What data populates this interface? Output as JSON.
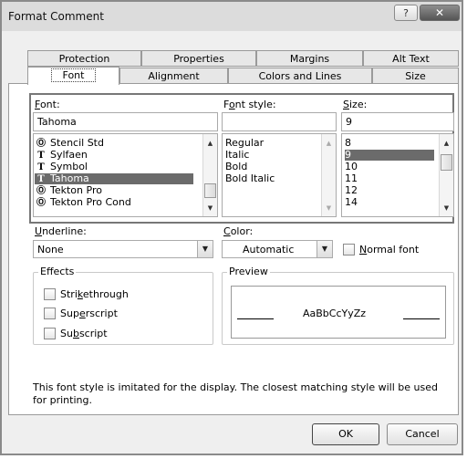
{
  "window": {
    "title": "Format Comment",
    "help_label": "?",
    "close_label": "✕"
  },
  "tabs_back": [
    "Protection",
    "Properties",
    "Margins",
    "Alt Text"
  ],
  "tabs_front": [
    "Font",
    "Alignment",
    "Colors and Lines",
    "Size"
  ],
  "active_tab": "Font",
  "font": {
    "label_prefix": "",
    "label_mnemonic": "F",
    "label_rest": "ont:",
    "value": "Tahoma",
    "items": [
      {
        "name": "Stencil Std",
        "icon": "printer-font-icon",
        "glyph": "Ⓞ"
      },
      {
        "name": "Sylfaen",
        "icon": "truetype-font-icon",
        "glyph": "T"
      },
      {
        "name": "Symbol",
        "icon": "truetype-font-icon",
        "glyph": "T"
      },
      {
        "name": "Tahoma",
        "icon": "truetype-font-icon",
        "glyph": "T",
        "selected": true
      },
      {
        "name": "Tekton Pro",
        "icon": "printer-font-icon",
        "glyph": "Ⓞ"
      },
      {
        "name": "Tekton Pro Cond",
        "icon": "printer-font-icon",
        "glyph": "Ⓞ"
      }
    ]
  },
  "font_style": {
    "label_prefix": "F",
    "label_mnemonic": "o",
    "label_rest": "nt style:",
    "value": "",
    "items": [
      "Regular",
      "Italic",
      "Bold",
      "Bold Italic"
    ]
  },
  "size": {
    "label_prefix": "",
    "label_mnemonic": "S",
    "label_rest": "ize:",
    "value": "9",
    "items": [
      "8",
      "9",
      "10",
      "11",
      "12",
      "14"
    ],
    "selected": "9"
  },
  "underline": {
    "label_prefix": "",
    "label_mnemonic": "U",
    "label_rest": "nderline:",
    "value": "None"
  },
  "color": {
    "label_prefix": "",
    "label_mnemonic": "C",
    "label_rest": "olor:",
    "value": "Automatic"
  },
  "normal_font": {
    "label_prefix": "",
    "label_mnemonic": "N",
    "label_rest": "ormal font",
    "checked": false
  },
  "effects": {
    "legend": "Effects",
    "items": [
      {
        "prefix": "Stri",
        "mnemonic": "k",
        "rest": "ethrough",
        "checked": false
      },
      {
        "prefix": "Sup",
        "mnemonic": "e",
        "rest": "rscript",
        "checked": false
      },
      {
        "prefix": "Su",
        "mnemonic": "b",
        "rest": "script",
        "checked": false
      }
    ]
  },
  "preview": {
    "legend": "Preview",
    "sample": "AaBbCcYyZz"
  },
  "info_text": "This font style is imitated for the display.  The closest matching style will be used for printing.",
  "buttons": {
    "ok": "OK",
    "cancel": "Cancel"
  },
  "colors": {
    "selection": "#6b6b6b",
    "group_border": "#777777",
    "dialog_bg": "#efefef"
  }
}
